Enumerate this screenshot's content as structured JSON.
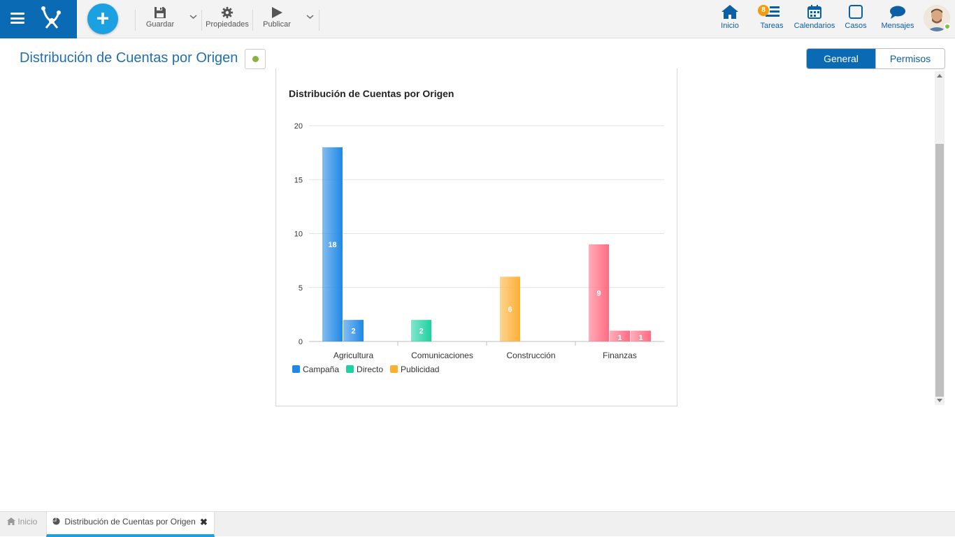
{
  "toolbar": {
    "save_label": "Guardar",
    "properties_label": "Propiedades",
    "publish_label": "Publicar"
  },
  "nav": {
    "home_label": "Inicio",
    "tasks_label": "Tareas",
    "tasks_count": "8",
    "calendars_label": "Calendarios",
    "cases_label": "Casos",
    "messages_label": "Mensajes"
  },
  "page": {
    "title": "Distribución de Cuentas por Origen",
    "tabs": [
      {
        "label": "General",
        "active": true
      },
      {
        "label": "Permisos",
        "active": false
      }
    ]
  },
  "colors": {
    "brand": "#0b6ab4",
    "accent": "#1ba1e2",
    "status": "#8ab43c",
    "badge": "#f39c12"
  },
  "chart_data": {
    "type": "bar",
    "title": "Distribución de Cuentas por Origen",
    "categories": [
      "Agricultura",
      "Comunicaciones",
      "Construcción",
      "Finanzas"
    ],
    "ylim": [
      0,
      20
    ],
    "yticks": [
      0,
      5,
      10,
      15,
      20
    ],
    "grid": true,
    "legend_position": "bottom-left",
    "series": [
      {
        "name": "Campaña",
        "color": "#1e88e5",
        "values": [
          18,
          2,
          0,
          9
        ]
      },
      {
        "name": "Directo",
        "color": "#1dd1a1",
        "values": [
          0,
          2,
          0,
          1
        ]
      },
      {
        "name": "Publicidad",
        "color": "#fbb034",
        "values": [
          0,
          0,
          6,
          1
        ]
      }
    ],
    "bars": [
      {
        "category": "Agricultura",
        "value": 18,
        "label": "18",
        "color": "#1e88e5"
      },
      {
        "category": "Agricultura",
        "value": 2,
        "label": "2",
        "color": "#1e88e5"
      },
      {
        "category": "Comunicaciones",
        "value": 2,
        "label": "2",
        "color": "#1dd1a1"
      },
      {
        "category": "Construcción",
        "value": 6,
        "label": "6",
        "color": "#fbb034"
      },
      {
        "category": "Finanzas",
        "value": 9,
        "label": "9",
        "color": "#ff6b81"
      },
      {
        "category": "Finanzas",
        "value": 1,
        "label": "1",
        "color": "#ff6b81"
      },
      {
        "category": "Finanzas",
        "value": 1,
        "label": "1",
        "color": "#ff6b81"
      }
    ]
  },
  "bottom_tabs": {
    "home_label": "Inicio",
    "chart_label": "Distribución de Cuentas por Origen"
  }
}
